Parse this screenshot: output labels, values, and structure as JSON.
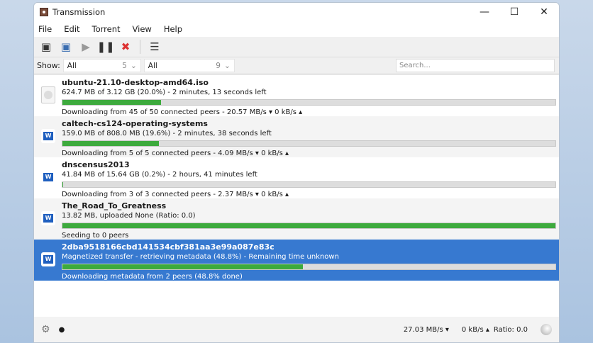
{
  "window": {
    "title": "Transmission",
    "minimize": "—",
    "maximize": "☐",
    "close": "✕"
  },
  "menu": [
    "File",
    "Edit",
    "Torrent",
    "View",
    "Help"
  ],
  "filter": {
    "label": "Show:",
    "activity": "All",
    "activity_count": "5",
    "tracker": "All",
    "tracker_count": "9",
    "search_placeholder": "Search..."
  },
  "torrents": [
    {
      "name": "ubuntu-21.10-desktop-amd64.iso",
      "info": "624.7 MB of 3.12 GB (20.0%) - 2 minutes, 13 seconds left",
      "status": "Downloading from 45 of 50 connected peers - 20.57 MB/s ▾  0 kB/s ▴",
      "progress": 20.0,
      "icon": "disc-file-icon"
    },
    {
      "name": "caltech-cs124-operating-systems",
      "info": "159.0 MB of 808.0 MB (19.6%) - 2 minutes, 38 seconds left",
      "status": "Downloading from 5 of 5 connected peers - 4.09 MB/s ▾  0 kB/s ▴",
      "progress": 19.6,
      "icon": "word-file-icon"
    },
    {
      "name": "dnscensus2013",
      "info": "41.84 MB of 15.64 GB (0.2%) - 2 hours, 41 minutes left",
      "status": "Downloading from 3 of 3 connected peers - 2.37 MB/s ▾  0 kB/s ▴",
      "progress": 0.2,
      "icon": "word-file-icon"
    },
    {
      "name": "The_Road_To_Greatness",
      "info": "13.82 MB, uploaded None (Ratio: 0.0)",
      "status": "Seeding to 0 peers",
      "progress": 100,
      "icon": "word-file-icon"
    },
    {
      "name": "2dba9518166cbd141534cbf381aa3e99a087e83c",
      "info": "Magnetized transfer - retrieving metadata (48.8%) - Remaining time unknown",
      "status": "Downloading metadata from 2 peers (48.8% done)",
      "progress": 48.8,
      "icon": "word-file-icon"
    }
  ],
  "statusbar": {
    "down": "27.03 MB/s ▾",
    "up": "0 kB/s ▴",
    "ratio": "Ratio: 0.0"
  },
  "colors": {
    "progress": "#3daa3d",
    "selected": "#3779d0"
  }
}
